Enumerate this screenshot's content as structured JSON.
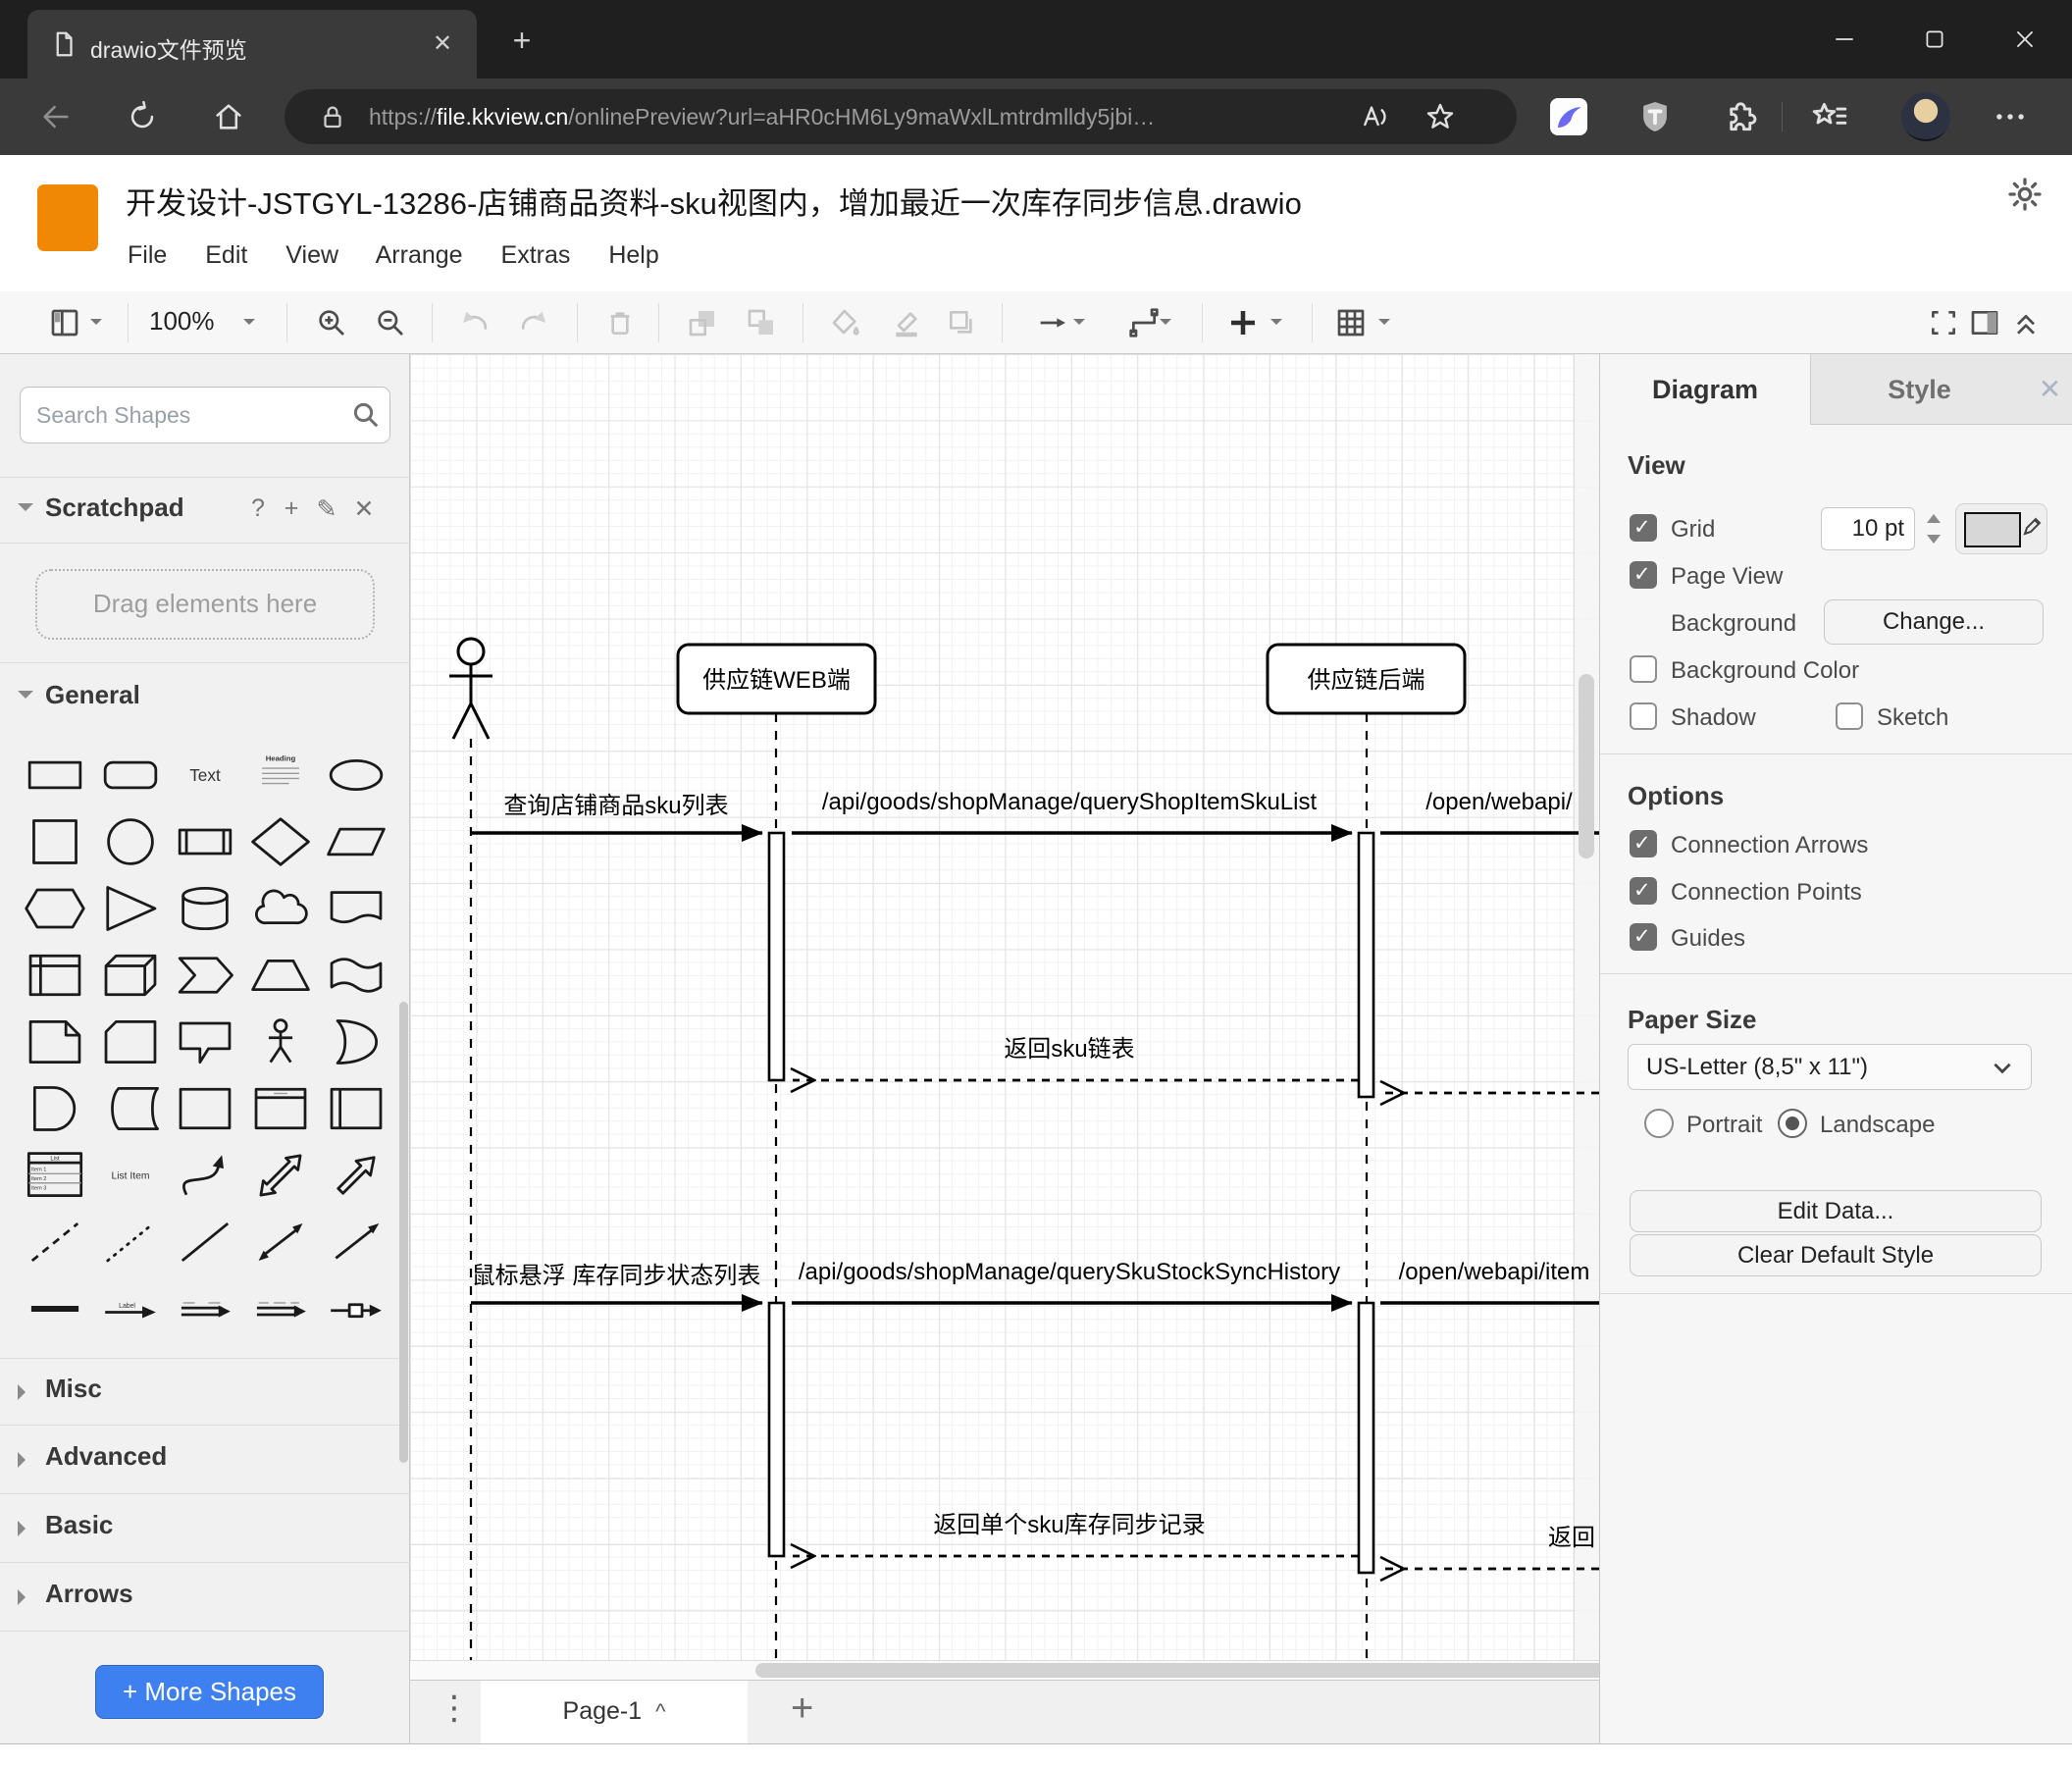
{
  "browser": {
    "tab_title": "drawio文件预览",
    "url": {
      "scheme": "https://",
      "host": "file.kkview.cn",
      "path": "/onlinePreview?url=aHR0cHM6Ly9maWxlLmtrdmlldy5jbi…"
    }
  },
  "header": {
    "title": "开发设计-JSTGYL-13286-店铺商品资料-sku视图内，增加最近一次库存同步信息.drawio",
    "menu": [
      "File",
      "Edit",
      "View",
      "Arrange",
      "Extras",
      "Help"
    ]
  },
  "toolbar": {
    "zoom": "100%"
  },
  "sidebar": {
    "search_placeholder": "Search Shapes",
    "scratchpad": "Scratchpad",
    "drag_hint": "Drag elements here",
    "sections": {
      "general": "General",
      "misc": "Misc",
      "advanced": "Advanced",
      "basic": "Basic",
      "arrows": "Arrows"
    },
    "more_shapes": "+ More Shapes",
    "shape_labels": {
      "text": "Text",
      "heading": "Heading",
      "list_title": "List",
      "list_items": [
        "Item 1",
        "Item 2",
        "Item 3"
      ],
      "list_item": "List Item",
      "label": "Label"
    },
    "shapes": [
      "rectangle",
      "rounded-rectangle",
      "text",
      "textbox",
      "ellipse",
      "square",
      "circle",
      "process",
      "diamond",
      "parallelogram",
      "hexagon",
      "triangle",
      "cylinder",
      "cloud",
      "document",
      "internal-storage",
      "cube",
      "step",
      "trapezoid",
      "tape",
      "note",
      "card",
      "callout",
      "actor",
      "or",
      "and",
      "data-storage",
      "container",
      "container-title",
      "vertical-container",
      "list",
      "list-item",
      "curve",
      "bidirectional-arrow",
      "arrow",
      "dashed-line",
      "dotted-line",
      "line",
      "bidirectional-connector",
      "directional-connector",
      "horizontal-line",
      "label-arrow",
      "link",
      "link-2",
      "arrow-box"
    ]
  },
  "diagram": {
    "lifelines": {
      "web": "供应链WEB端",
      "backend": "供应链后端"
    },
    "messages": {
      "q1": "查询店铺商品sku列表",
      "api1": "/api/goods/shopManage/queryShopItemSkuList",
      "open1": "/open/webapi/",
      "ret1": "返回sku链表",
      "q2": "鼠标悬浮 库存同步状态列表",
      "api2": "/api/goods/shopManage/querySkuStockSyncHistory",
      "open2": "/open/webapi/item",
      "ret2": "返回单个sku库存同步记录",
      "ret3": "返回"
    }
  },
  "panel": {
    "tabs": {
      "diagram": "Diagram",
      "style": "Style"
    },
    "view": {
      "title": "View",
      "grid": "Grid",
      "grid_size": "10 pt",
      "page_view": "Page View",
      "background": "Background",
      "change": "Change...",
      "background_color": "Background Color",
      "shadow": "Shadow",
      "sketch": "Sketch",
      "grid_on": true,
      "page_view_on": true,
      "background_color_on": false,
      "shadow_on": false,
      "sketch_on": false
    },
    "options": {
      "title": "Options",
      "connection_arrows": "Connection Arrows",
      "connection_points": "Connection Points",
      "guides": "Guides",
      "connection_arrows_on": true,
      "connection_points_on": true,
      "guides_on": true
    },
    "paper": {
      "title": "Paper Size",
      "size": "US-Letter (8,5\" x 11\")",
      "portrait": "Portrait",
      "landscape": "Landscape",
      "portrait_on": false,
      "landscape_on": true
    },
    "buttons": {
      "edit_data": "Edit Data...",
      "clear_default_style": "Clear Default Style"
    }
  },
  "footer": {
    "page": "Page-1"
  }
}
